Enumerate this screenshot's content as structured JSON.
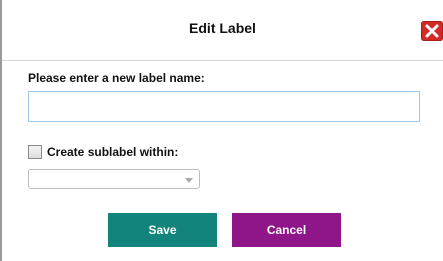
{
  "dialog": {
    "title": "Edit Label",
    "close_icon": "close-x-icon",
    "close_color": "#d42a27"
  },
  "form": {
    "prompt_label": "Please enter a new label name:",
    "name_input": {
      "value": "",
      "placeholder": ""
    },
    "sublabel_checkbox": {
      "label": "Create sublabel within:",
      "checked": false
    },
    "parent_select": {
      "selected": "",
      "icon": "chevron-down-icon"
    }
  },
  "buttons": {
    "save_label": "Save",
    "save_color": "#12847c",
    "cancel_label": "Cancel",
    "cancel_color": "#8f1688"
  }
}
